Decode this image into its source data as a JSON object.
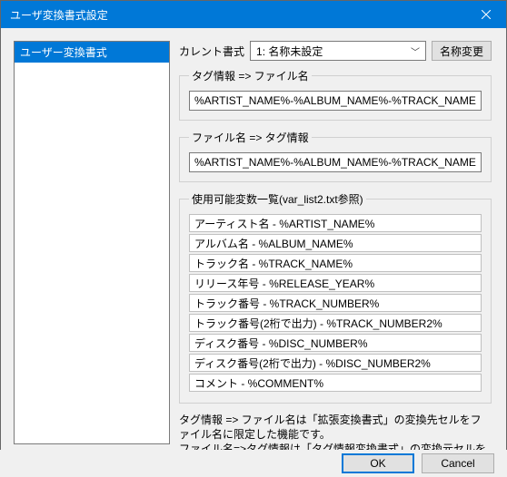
{
  "window": {
    "title": "ユーザ変換書式設定"
  },
  "sidebar": {
    "items": [
      {
        "label": "ユーザー変換書式"
      }
    ]
  },
  "current": {
    "label": "カレント書式",
    "selected": "1: 名称未設定",
    "rename_label": "名称変更"
  },
  "tag_to_file": {
    "legend": "タグ情報 => ファイル名",
    "value": "%ARTIST_NAME%-%ALBUM_NAME%-%TRACK_NAME%"
  },
  "file_to_tag": {
    "legend": "ファイル名 => タグ情報",
    "value": "%ARTIST_NAME%-%ALBUM_NAME%-%TRACK_NAME%"
  },
  "variables": {
    "legend": "使用可能変数一覧(var_list2.txt参照)",
    "items": [
      "アーティスト名 - %ARTIST_NAME%",
      "アルバム名 - %ALBUM_NAME%",
      "トラック名 - %TRACK_NAME%",
      "リリース年号 - %RELEASE_YEAR%",
      "トラック番号 - %TRACK_NUMBER%",
      "トラック番号(2桁で出力) - %TRACK_NUMBER2%",
      "ディスク番号 - %DISC_NUMBER%",
      "ディスク番号(2桁で出力) - %DISC_NUMBER2%",
      "コメント - %COMMENT%"
    ]
  },
  "note": {
    "line1": "タグ情報 => ファイル名は「拡張変換書式」の変換先セルをファイル名に限定した機能です。",
    "line2": "ファイル名=>タグ情報は「タグ情報変換書式」の変換元セルをファイル名に限定した機能です。"
  },
  "footer": {
    "ok": "OK",
    "cancel": "Cancel"
  }
}
